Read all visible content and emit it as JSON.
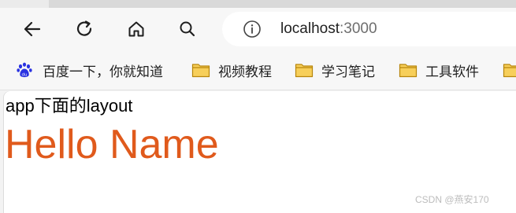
{
  "browser": {
    "address_bar": {
      "host": "localhost",
      "port": ":3000"
    },
    "bookmarks": [
      {
        "label": "百度一下，你就知道",
        "icon": "baidu-paw-icon"
      },
      {
        "label": "视频教程",
        "icon": "folder-icon"
      },
      {
        "label": "学习笔记",
        "icon": "folder-icon"
      },
      {
        "label": "工具软件",
        "icon": "folder-icon"
      }
    ]
  },
  "page": {
    "layout_text": "app下面的layout",
    "heading": "Hello Name",
    "heading_color": "#e05a1c"
  },
  "watermark": "CSDN @燕安170"
}
